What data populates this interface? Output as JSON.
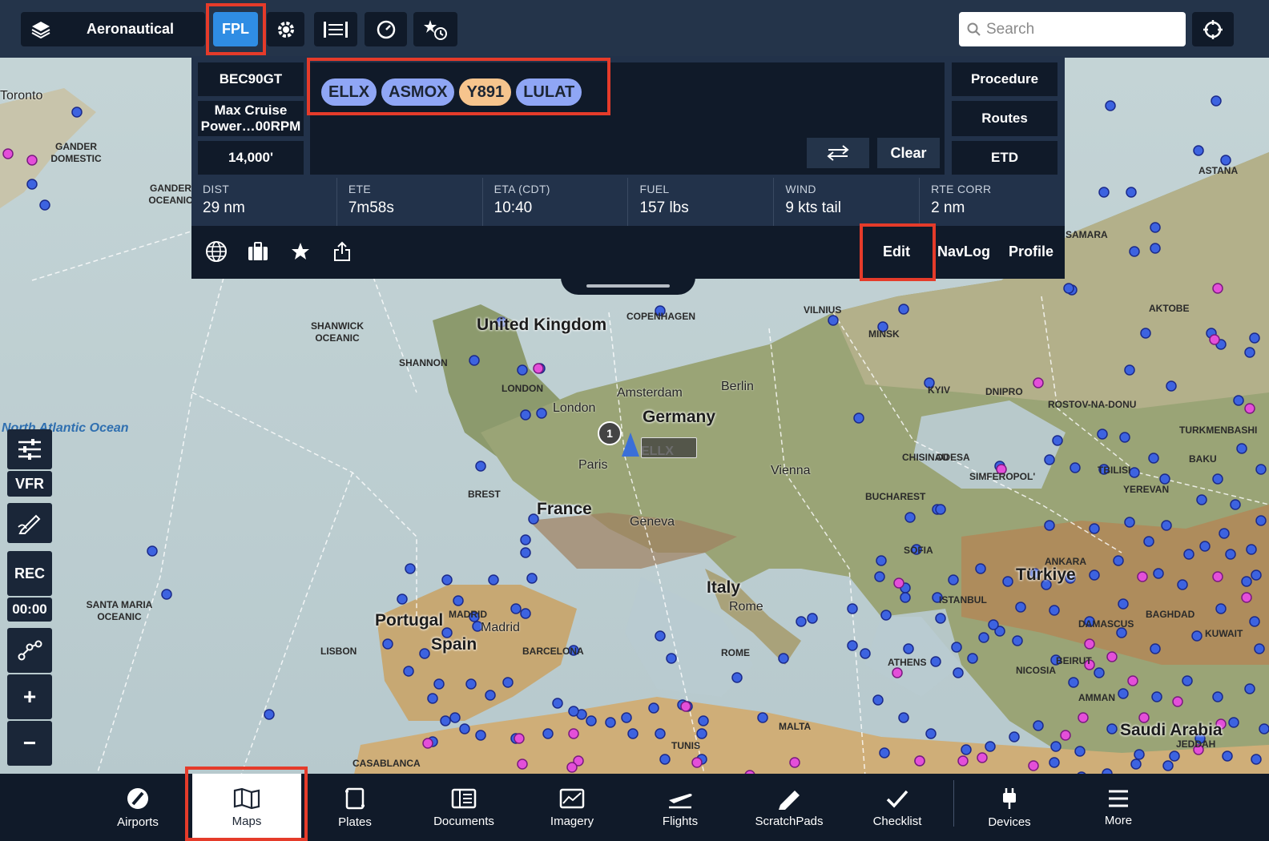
{
  "topbar": {
    "layer_label": "Aeronautical",
    "fpl_label": "FPL",
    "search_placeholder": "Search"
  },
  "flight_plan": {
    "aircraft": "BEC90GT",
    "profile": "Max Cruise Power…00RPM",
    "altitude": "14,000'",
    "route": [
      {
        "id": "ELLX",
        "kind": "waypoint"
      },
      {
        "id": "ASMOX",
        "kind": "waypoint"
      },
      {
        "id": "Y891",
        "kind": "airway"
      },
      {
        "id": "LULAT",
        "kind": "waypoint"
      }
    ],
    "clear_label": "Clear",
    "side_buttons": [
      "Procedure",
      "Routes",
      "ETD"
    ],
    "stats": [
      {
        "label": "DIST",
        "value": "29 nm"
      },
      {
        "label": "ETE",
        "value": "7m58s"
      },
      {
        "label": "ETA (CDT)",
        "value": "10:40"
      },
      {
        "label": "FUEL",
        "value": "157 lbs"
      },
      {
        "label": "WIND",
        "value": "9 kts tail"
      },
      {
        "label": "RTE CORR",
        "value": "2 nm"
      }
    ],
    "tabs": {
      "edit": "Edit",
      "navlog": "NavLog",
      "profile": "Profile"
    }
  },
  "left_tools": {
    "vfr": "VFR",
    "rec": "REC",
    "timer": "00:00",
    "zoom_in": "+",
    "zoom_out": "−"
  },
  "map": {
    "labels": [
      {
        "text": "Toronto",
        "cls": "city"
      },
      {
        "text": "GANDER DOMESTIC",
        "cls": ""
      },
      {
        "text": "GANDER OCEANIC",
        "cls": ""
      },
      {
        "text": "SHANWICK OCEANIC",
        "cls": ""
      },
      {
        "text": "SHANNON",
        "cls": ""
      },
      {
        "text": "United Kingdom",
        "cls": "big"
      },
      {
        "text": "LONDON",
        "cls": ""
      },
      {
        "text": "London",
        "cls": "city"
      },
      {
        "text": "Amsterdam",
        "cls": "city"
      },
      {
        "text": "Berlin",
        "cls": "city"
      },
      {
        "text": "COPENHAGEN",
        "cls": ""
      },
      {
        "text": "VILNIUS",
        "cls": ""
      },
      {
        "text": "MINSK",
        "cls": ""
      },
      {
        "text": "Germany",
        "cls": "big"
      },
      {
        "text": "Paris",
        "cls": "city"
      },
      {
        "text": "BREST",
        "cls": ""
      },
      {
        "text": "France",
        "cls": "big"
      },
      {
        "text": "Geneva",
        "cls": "city"
      },
      {
        "text": "Vienna",
        "cls": "city"
      },
      {
        "text": "BUCHAREST",
        "cls": ""
      },
      {
        "text": "SOFIA",
        "cls": ""
      },
      {
        "text": "Italy",
        "cls": "big"
      },
      {
        "text": "Rome",
        "cls": "city"
      },
      {
        "text": "ROME",
        "cls": ""
      },
      {
        "text": "MADRID",
        "cls": ""
      },
      {
        "text": "Madrid",
        "cls": "city"
      },
      {
        "text": "Portugal",
        "cls": "big"
      },
      {
        "text": "Spain",
        "cls": "big"
      },
      {
        "text": "BARCELONA",
        "cls": ""
      },
      {
        "text": "LISBON",
        "cls": ""
      },
      {
        "text": "SANTA MARIA OCEANIC",
        "cls": ""
      },
      {
        "text": "CASABLANCA",
        "cls": ""
      },
      {
        "text": "MALTA",
        "cls": ""
      },
      {
        "text": "TUNIS",
        "cls": ""
      },
      {
        "text": "ATHENS",
        "cls": ""
      },
      {
        "text": "ISTANBUL",
        "cls": ""
      },
      {
        "text": "ANKARA",
        "cls": ""
      },
      {
        "text": "Türkiye",
        "cls": "big"
      },
      {
        "text": "KYIV",
        "cls": ""
      },
      {
        "text": "DNIPRO",
        "cls": ""
      },
      {
        "text": "ROSTOV-NA-DONU",
        "cls": ""
      },
      {
        "text": "CHISINAU",
        "cls": ""
      },
      {
        "text": "ODESA",
        "cls": ""
      },
      {
        "text": "SIMFEROPOL'",
        "cls": ""
      },
      {
        "text": "TBILISI",
        "cls": ""
      },
      {
        "text": "YEREVAN",
        "cls": ""
      },
      {
        "text": "BAKU",
        "cls": ""
      },
      {
        "text": "NICOSIA",
        "cls": ""
      },
      {
        "text": "BEIRUT",
        "cls": ""
      },
      {
        "text": "DAMASCUS",
        "cls": ""
      },
      {
        "text": "AMMAN",
        "cls": ""
      },
      {
        "text": "Saudi Arabia",
        "cls": "big"
      },
      {
        "text": "JEDDAH",
        "cls": ""
      },
      {
        "text": "KUWAIT",
        "cls": ""
      },
      {
        "text": "BAGHDAD",
        "cls": ""
      },
      {
        "text": "ASTANA",
        "cls": ""
      },
      {
        "text": "SAMARA",
        "cls": ""
      },
      {
        "text": "AKTOBE",
        "cls": ""
      },
      {
        "text": "TURKMENBASHI",
        "cls": ""
      },
      {
        "text": "North Atlantic Ocean",
        "cls": "ocean"
      },
      {
        "text": "ELLX",
        "cls": ""
      }
    ]
  },
  "bottom_nav": [
    {
      "label": "Airports",
      "icon": "airport-icon"
    },
    {
      "label": "Maps",
      "icon": "map-icon",
      "active": true
    },
    {
      "label": "Plates",
      "icon": "plates-icon"
    },
    {
      "label": "Documents",
      "icon": "documents-icon"
    },
    {
      "label": "Imagery",
      "icon": "imagery-icon"
    },
    {
      "label": "Flights",
      "icon": "flights-icon"
    },
    {
      "label": "ScratchPads",
      "icon": "scratchpad-icon"
    },
    {
      "label": "Checklist",
      "icon": "checklist-icon"
    },
    {
      "label": "Devices",
      "icon": "devices-icon"
    },
    {
      "label": "More",
      "icon": "more-icon"
    }
  ],
  "colors": {
    "accent": "#2f8de4",
    "highlight": "#e53b2a",
    "waypoint_chip": "#8fa6f5",
    "airway_chip": "#f6c48d",
    "panel": "#101a29"
  }
}
